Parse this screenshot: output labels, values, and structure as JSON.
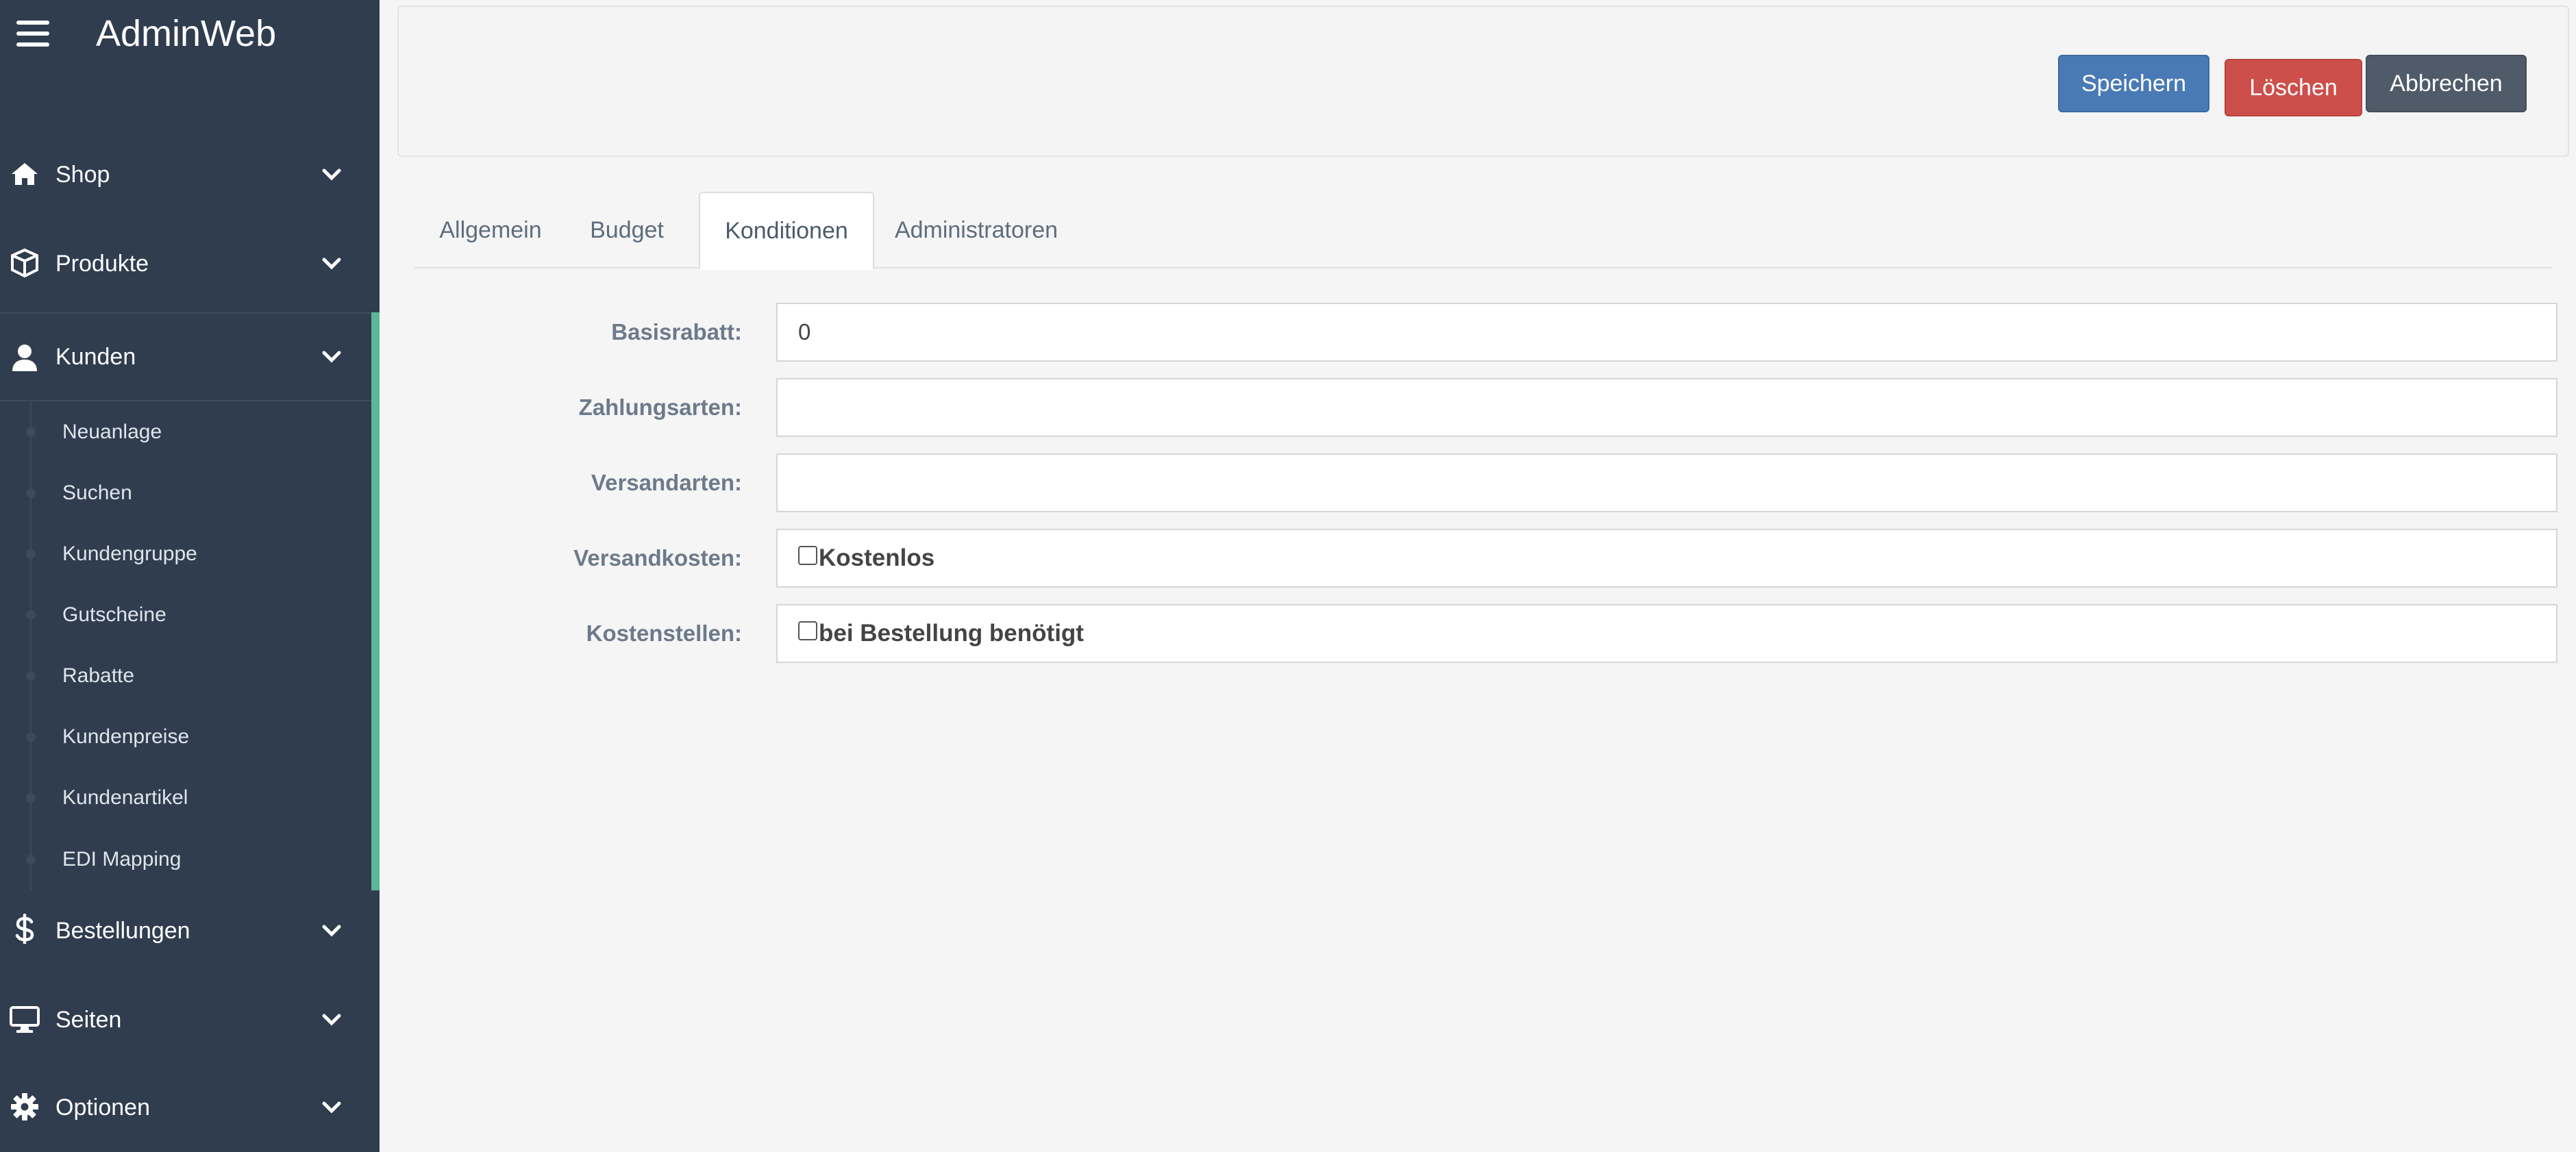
{
  "app": {
    "title": "AdminWeb",
    "menu_icon": "hamburger-menu-icon"
  },
  "sidebar": {
    "items": [
      {
        "label": "Shop",
        "icon": "home-icon"
      },
      {
        "label": "Produkte",
        "icon": "box-icon"
      },
      {
        "label": "Kunden",
        "icon": "user-icon",
        "expanded": true
      },
      {
        "label": "Bestellungen",
        "icon": "dollar-icon"
      },
      {
        "label": "Seiten",
        "icon": "monitor-icon"
      },
      {
        "label": "Optionen",
        "icon": "gear-icon"
      }
    ],
    "submenu": [
      {
        "label": "Neuanlage"
      },
      {
        "label": "Suchen"
      },
      {
        "label": "Kundengruppe"
      },
      {
        "label": "Gutscheine"
      },
      {
        "label": "Rabatte"
      },
      {
        "label": "Kundenpreise"
      },
      {
        "label": "Kundenartikel"
      },
      {
        "label": "EDI Mapping"
      }
    ],
    "accent_color": "#5bb795",
    "background_color": "#2f3d4f"
  },
  "toolbar": {
    "save_label": "Speichern",
    "delete_label": "Löschen",
    "cancel_label": "Abbrechen",
    "colors": {
      "save": "#4a7ab5",
      "delete": "#cc4f4b",
      "cancel": "#4f5b69"
    }
  },
  "tabs": [
    {
      "label": "Allgemein",
      "active": false
    },
    {
      "label": "Budget",
      "active": false
    },
    {
      "label": "Konditionen",
      "active": true
    },
    {
      "label": "Administratoren",
      "active": false
    }
  ],
  "form": {
    "basisrabatt": {
      "label": "Basisrabatt:",
      "value": "0"
    },
    "zahlungsarten": {
      "label": "Zahlungsarten:",
      "value": ""
    },
    "versandarten": {
      "label": "Versandarten:",
      "value": ""
    },
    "versandkosten": {
      "label": "Versandkosten:",
      "checkbox_label": "Kostenlos",
      "checked": false
    },
    "kostenstellen": {
      "label": "Kostenstellen:",
      "checkbox_label": "bei Bestellung benötigt",
      "checked": false
    }
  }
}
